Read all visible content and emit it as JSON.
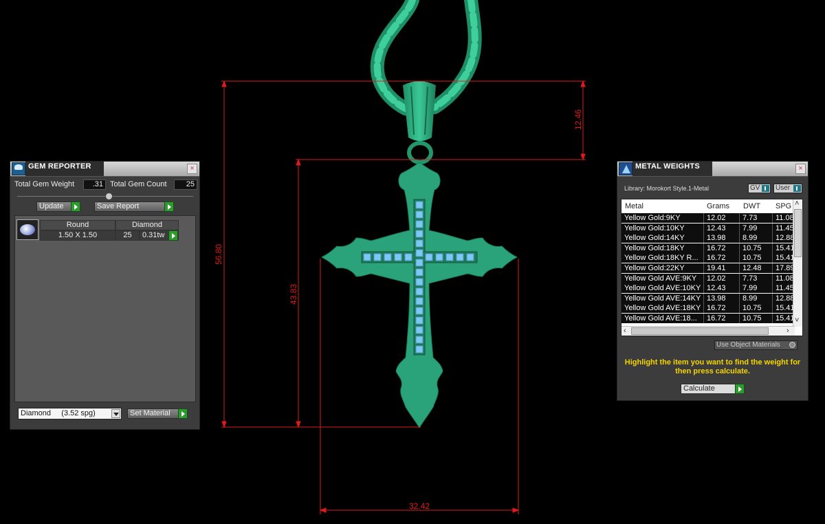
{
  "dimensions": {
    "height_total": "56.80",
    "height_cross": "43.83",
    "bail_height": "12.46",
    "width": "32.42"
  },
  "gem_reporter": {
    "title": "GEM REPORTER",
    "total_weight_label": "Total Gem Weight",
    "total_weight_value": ".31",
    "total_count_label": "Total Gem Count",
    "total_count_value": "25",
    "update_label": "Update",
    "save_report_label": "Save Report",
    "gem_row": {
      "shape": "Round",
      "material": "Diamond",
      "size": "1.50 X 1.50",
      "count": "25",
      "weight": "0.31tw"
    },
    "material_select": "Diamond     (3.52 spg)",
    "set_material_label": "Set Material"
  },
  "metal_weights": {
    "title": "METAL WEIGHTS",
    "library": "Library: Morokort Style.1-Metal",
    "toggle_gv": "GV",
    "toggle_user": "User",
    "columns": [
      "Metal",
      "Grams",
      "DWT",
      "SPG"
    ],
    "rows": [
      [
        "Yellow Gold:9KY",
        "12.02",
        "7.73",
        "11.08"
      ],
      [
        "Yellow Gold:10KY",
        "12.43",
        "7.99",
        "11.45"
      ],
      [
        "Yellow Gold:14KY",
        "13.98",
        "8.99",
        "12.88"
      ],
      [
        "Yellow Gold:18KY",
        "16.72",
        "10.75",
        "15.41"
      ],
      [
        "Yellow Gold:18KY R...",
        "16.72",
        "10.75",
        "15.41"
      ],
      [
        "Yellow Gold:22KY",
        "19.41",
        "12.48",
        "17.89"
      ],
      [
        "Yellow Gold AVE:9KY",
        "12.02",
        "7.73",
        "11.08"
      ],
      [
        "Yellow Gold AVE:10KY",
        "12.43",
        "7.99",
        "11.45"
      ],
      [
        "Yellow Gold AVE:14KY",
        "13.98",
        "8.99",
        "12.88"
      ],
      [
        "Yellow Gold AVE:18KY",
        "16.72",
        "10.75",
        "15.41"
      ],
      [
        "Yellow Gold AVE:18...",
        "16.72",
        "10.75",
        "15.41"
      ]
    ],
    "use_object_materials": "Use Object Materials",
    "hint": "Highlight the item you want to find the weight for then press calculate.",
    "calculate_label": "Calculate"
  },
  "colors": {
    "model": "#2aa37a",
    "gems": "#79c6f0",
    "dimension_lines": "#e01a1a"
  }
}
